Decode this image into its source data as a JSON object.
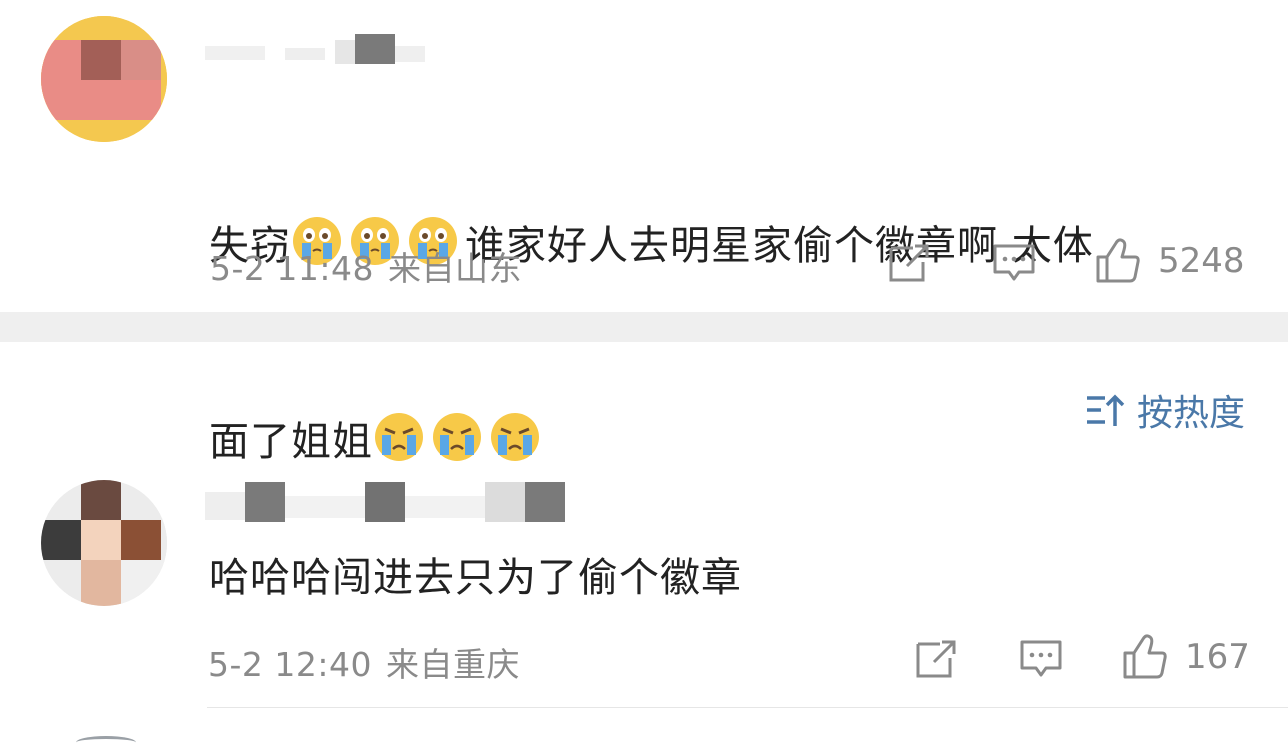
{
  "comments": [
    {
      "text_line1": "失窃",
      "text_line1_after": "谁家好人去明星家偷个徽章啊 太体",
      "text_line2": "面了姐姐",
      "emoji_line1": [
        "crying-emoji",
        "crying-emoji",
        "crying-emoji"
      ],
      "emoji_line2": [
        "sobbing-emoji",
        "sobbing-emoji",
        "sobbing-emoji"
      ],
      "time": "5-2 11:48",
      "location": "来自山东",
      "likes": "5248"
    },
    {
      "text": "哈哈哈闯进去只为了偷个徽章",
      "time": "5-2 12:40",
      "location": "来自重庆",
      "likes": "167"
    }
  ],
  "sort": {
    "label": "按热度",
    "icon": "sort-icon"
  },
  "colors": {
    "link": "#4a78a8",
    "meta": "#8a8a8a",
    "divider": "#efefef"
  }
}
